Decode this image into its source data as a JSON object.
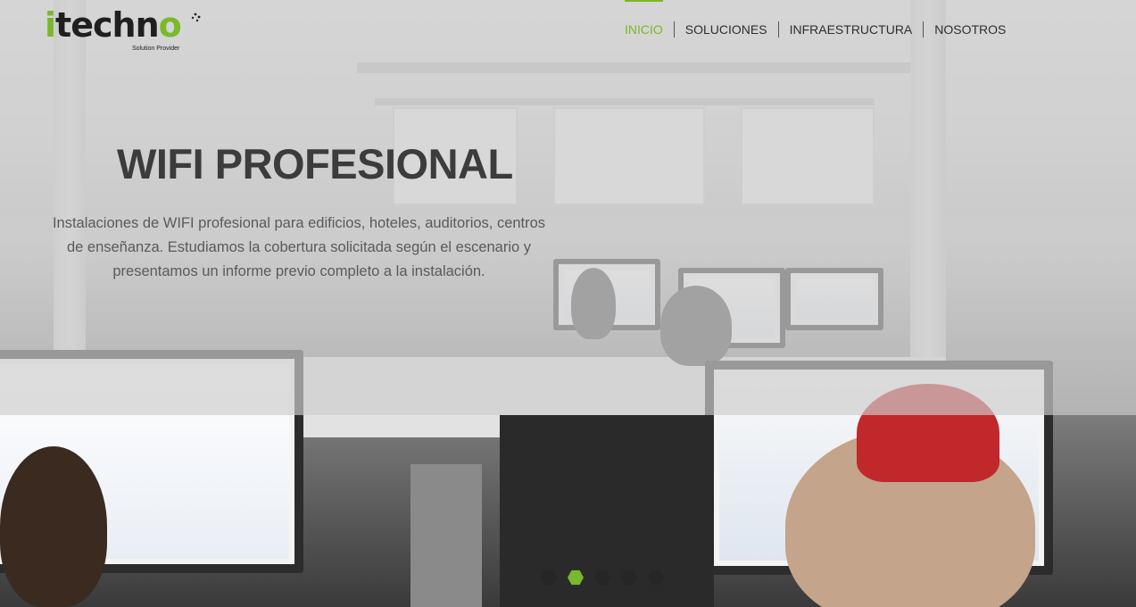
{
  "brand": {
    "logo_main": "itechno",
    "logo_tagline": "Solution Provider",
    "accent_color": "#7ab929"
  },
  "nav": {
    "items": [
      {
        "label": "INICIO",
        "active": true
      },
      {
        "label": "SOLUCIONES",
        "active": false
      },
      {
        "label": "INFRAESTRUCTURA",
        "active": false
      },
      {
        "label": "NOSOTROS",
        "active": false
      }
    ]
  },
  "hero": {
    "title": "WIFI PROFESIONAL",
    "description": "Instalaciones de WIFI profesional para edificios, hoteles, auditorios, centros de enseñanza. Estudiamos la cobertura solicitada según el escenario y presentamos un informe previo completo a la instalación."
  },
  "slider": {
    "slide_count": 5,
    "active_index": 1
  }
}
